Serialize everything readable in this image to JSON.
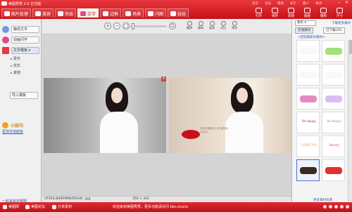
{
  "app": {
    "title": "美图秀秀 2.0 正式版",
    "header_links": [
      "首页",
      "论坛",
      "帮助",
      "关于",
      "最小",
      "关闭"
    ],
    "tabs": [
      {
        "label": "图片处理",
        "icon": "image-icon"
      },
      {
        "label": "美容",
        "icon": "face-icon"
      },
      {
        "label": "饰品",
        "icon": "heart-icon"
      },
      {
        "label": "文字",
        "icon": "text-icon",
        "active": true
      },
      {
        "label": "边框",
        "icon": "frame-icon"
      },
      {
        "label": "场景",
        "icon": "scene-icon"
      },
      {
        "label": "闪图",
        "icon": "flash-icon"
      },
      {
        "label": "娃娃",
        "icon": "doll-icon"
      }
    ],
    "tools": [
      "打开",
      "保存",
      "新建",
      "截图",
      "撤销",
      "尺寸",
      "设置"
    ]
  },
  "left_panel": {
    "static_text": "静态文字",
    "animated_text": "动画闪字",
    "template_select": "文字模板",
    "sub_items": [
      "爱乐",
      "优乐",
      "其他"
    ],
    "import_button": "导入模板",
    "tip_title": "小技巧",
    "tip_link": "更改字体颜色",
    "bottom_link": "一起来看完整图"
  },
  "canvas_toolbar": {
    "edit_buttons": [
      "撤销",
      "重做",
      "复原",
      "对比",
      "预览"
    ]
  },
  "status": {
    "filename": "d7301c8d959f9b505e0f...jpg",
    "dimensions": "350 × 343"
  },
  "photo_note": "把你的爱藏在心里 微笑面对生活",
  "right_panel": {
    "select": "爱乐",
    "download_link": "下载更多素材",
    "tabs": [
      "在线素材",
      "已下载(26)"
    ],
    "hint": "<回答最新的素材>",
    "stickers": [
      {
        "text": "",
        "color": "#f8f8f8"
      },
      {
        "text": "",
        "color": "#a5e07a"
      },
      {
        "text": "",
        "color": "#f8f8f8"
      },
      {
        "text": "",
        "color": "#f8f8f8"
      },
      {
        "text": "",
        "color": "#e48bc3"
      },
      {
        "text": "",
        "color": "#d6c0f0"
      },
      {
        "text": "Be Happy",
        "color": "#c02080"
      },
      {
        "text": "Be Happy!",
        "color": "#9b9b9b"
      },
      {
        "text": "I LOVE YOU",
        "color": "#f4a030"
      },
      {
        "text": "Beauty",
        "color": "#e04a8c"
      },
      {
        "text": "",
        "color": "#3a2a20"
      },
      {
        "text": "",
        "color": "#e03030"
      }
    ],
    "bottom_link": "更多素材资源"
  },
  "bottom_bar": {
    "items": [
      "美图网",
      "美图论坛",
      "分享素材"
    ],
    "message": "欢迎来到美图秀秀，更多功能请访问 bbs.xiuxiu"
  }
}
